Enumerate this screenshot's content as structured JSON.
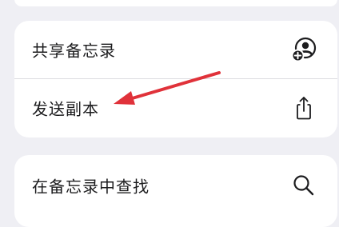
{
  "menu": {
    "items": [
      {
        "label": "共享备忘录",
        "icon": "share-note-person-plus-icon"
      },
      {
        "label": "发送副本",
        "icon": "share-upload-icon"
      }
    ],
    "find": {
      "label": "在备忘录中查找",
      "icon": "search-icon"
    }
  },
  "annotation": {
    "color": "#e0323a",
    "icon": "red-pointer-arrow"
  }
}
